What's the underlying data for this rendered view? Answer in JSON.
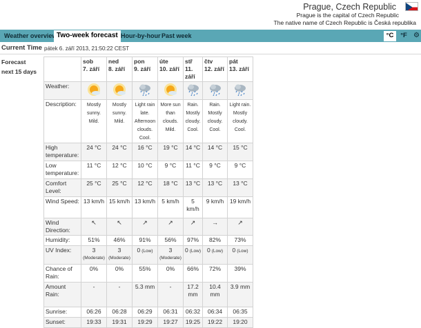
{
  "header": {
    "location": "Prague, Czech Republic",
    "capital_note": "Prague is the capital of Czech Republic",
    "native_note": "The native name of Czech Republic is Česká republika"
  },
  "tabs": [
    {
      "label": "Weather overview",
      "active": false
    },
    {
      "label": "Two-week forecast",
      "active": true
    },
    {
      "label": "Hour-by-hour",
      "active": false
    },
    {
      "label": "Past week",
      "active": false
    }
  ],
  "units": {
    "celsius": "°C",
    "fahrenheit": "°F",
    "active": "°C"
  },
  "current_time": {
    "label": "Current Time",
    "value": "pátek 6. září 2013, 21:50:22 CEST"
  },
  "forecast_label": {
    "line1": "Forecast",
    "line2": "next 15 days"
  },
  "row_labels": {
    "weather": "Weather:",
    "description": "Description:",
    "high": "High temperature:",
    "low": "Low temperature:",
    "comfort": "Comfort Level:",
    "wind_speed": "Wind Speed:",
    "wind_dir": "Wind Direction:",
    "humidity": "Humidity:",
    "uv": "UV Index:",
    "rain_chance": "Chance of Rain:",
    "rain_amount": "Amount Rain:",
    "sunrise": "Sunrise:",
    "sunset": "Sunset:"
  },
  "days": [
    {
      "dow": "sob",
      "date": "7. září",
      "icon": "sunny-icon",
      "desc": "Mostly sunny. Mild.",
      "high": "24 °C",
      "low": "11 °C",
      "comfort": "25 °C",
      "wind_speed": "13 km/h",
      "wind_dir": "↖",
      "humidity": "51%",
      "uv": "3",
      "uv_level": "(Moderate)",
      "rain_chance": "0%",
      "rain_amount": "-",
      "sunrise": "06:26",
      "sunset": "19:33"
    },
    {
      "dow": "ned",
      "date": "8. září",
      "icon": "sunny-icon",
      "desc": "Mostly sunny. Mild.",
      "high": "24 °C",
      "low": "12 °C",
      "comfort": "25 °C",
      "wind_speed": "15 km/h",
      "wind_dir": "↖",
      "humidity": "46%",
      "uv": "3",
      "uv_level": "(Moderate)",
      "rain_chance": "0%",
      "rain_amount": "-",
      "sunrise": "06:28",
      "sunset": "19:31"
    },
    {
      "dow": "pon",
      "date": "9. září",
      "icon": "rain-icon",
      "desc": "Light rain late. Afternoon clouds. Cool.",
      "high": "16 °C",
      "low": "10 °C",
      "comfort": "12 °C",
      "wind_speed": "13 km/h",
      "wind_dir": "↗",
      "humidity": "91%",
      "uv": "0",
      "uv_level": "(Low)",
      "rain_chance": "55%",
      "rain_amount": "5.3 mm",
      "sunrise": "06:29",
      "sunset": "19:29"
    },
    {
      "dow": "úte",
      "date": "10. září",
      "icon": "sunny-icon",
      "desc": "More sun than clouds. Mild.",
      "high": "19 °C",
      "low": "9 °C",
      "comfort": "18 °C",
      "wind_speed": "5 km/h",
      "wind_dir": "↗",
      "humidity": "56%",
      "uv": "3",
      "uv_level": "(Moderate)",
      "rain_chance": "0%",
      "rain_amount": "-",
      "sunrise": "06:31",
      "sunset": "19:27"
    },
    {
      "dow": "stř",
      "date": "11. září",
      "icon": "rain-icon",
      "desc": "Rain. Mostly cloudy. Cool.",
      "high": "14 °C",
      "low": "11 °C",
      "comfort": "13 °C",
      "wind_speed": "5 km/h",
      "wind_dir": "↗",
      "humidity": "97%",
      "uv": "0",
      "uv_level": "(Low)",
      "rain_chance": "66%",
      "rain_amount": "17.2 mm",
      "sunrise": "06:32",
      "sunset": "19:25"
    },
    {
      "dow": "čtv",
      "date": "12. září",
      "icon": "rain-icon",
      "desc": "Rain. Mostly cloudy. Cool.",
      "high": "14 °C",
      "low": "9 °C",
      "comfort": "13 °C",
      "wind_speed": "9 km/h",
      "wind_dir": "→",
      "humidity": "82%",
      "uv": "0",
      "uv_level": "(Low)",
      "rain_chance": "72%",
      "rain_amount": "10.4 mm",
      "sunrise": "06:34",
      "sunset": "19:22"
    },
    {
      "dow": "pát",
      "date": "13. září",
      "icon": "rain-icon",
      "desc": "Light rain. Mostly cloudy. Cool.",
      "high": "15 °C",
      "low": "9 °C",
      "comfort": "13 °C",
      "wind_speed": "19 km/h",
      "wind_dir": "↗",
      "humidity": "73%",
      "uv": "0",
      "uv_level": "(Low)",
      "rain_chance": "39%",
      "rain_amount": "3.9 mm",
      "sunrise": "06:35",
      "sunset": "19:20"
    }
  ]
}
